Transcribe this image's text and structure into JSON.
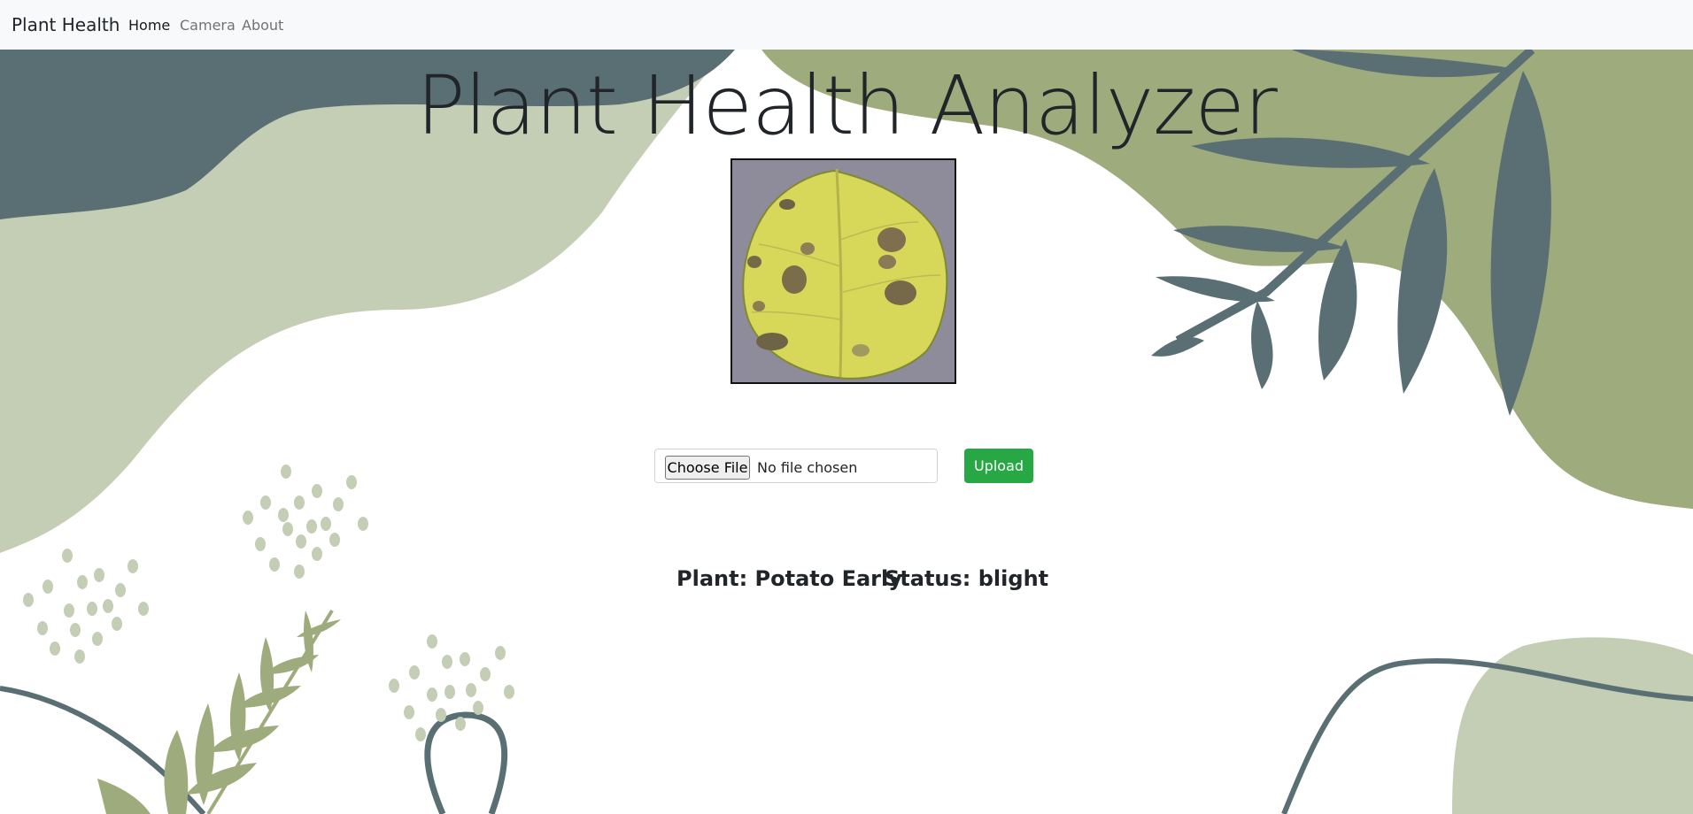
{
  "navbar": {
    "brand": "Plant Health",
    "links": [
      {
        "label": "Home",
        "active": true
      },
      {
        "label": "Camera",
        "active": false
      },
      {
        "label": "About",
        "active": false
      }
    ]
  },
  "main": {
    "title": "Plant Health Analyzer",
    "file_input": {
      "button_label": "Choose File",
      "status": "No file chosen"
    },
    "upload_label": "Upload",
    "result": {
      "plant": "Plant: Potato Early",
      "status": "Status: blight"
    }
  },
  "colors": {
    "dark_teal": "#5a6f73",
    "sage": "#9dab7d",
    "light_sage": "#c4ceb5",
    "upload_green": "#28a745"
  }
}
